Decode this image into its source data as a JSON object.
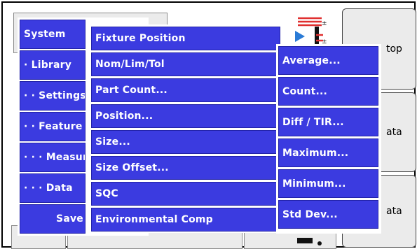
{
  "colors": {
    "menu_item": "#3b3be0",
    "menu_border": "#2222a8",
    "panel": "#ebebeb",
    "icon_red": "#e03030",
    "icon_blue": "#2a7bd6"
  },
  "right_buttons": {
    "b1": "top",
    "b2": "ata",
    "b3": "ata"
  },
  "menu1": [
    "System",
    "· Library",
    "· · Settings",
    "· · Feature",
    "· · · Measurem",
    "· · · Data",
    "Save"
  ],
  "menu2": [
    "Fixture Position",
    "Nom/Lim/Tol",
    "Part Count...",
    "Position...",
    "Size...",
    "Size Offset...",
    "SQC",
    "Environmental Comp"
  ],
  "menu3": [
    "Average...",
    "Count...",
    "Diff / TIR...",
    "Maximum...",
    "Minimum...",
    "Std Dev..."
  ],
  "icons": {
    "top": "fixture-status-icon",
    "arrow": "play-arrow-icon",
    "bottom": "probe-icon"
  }
}
